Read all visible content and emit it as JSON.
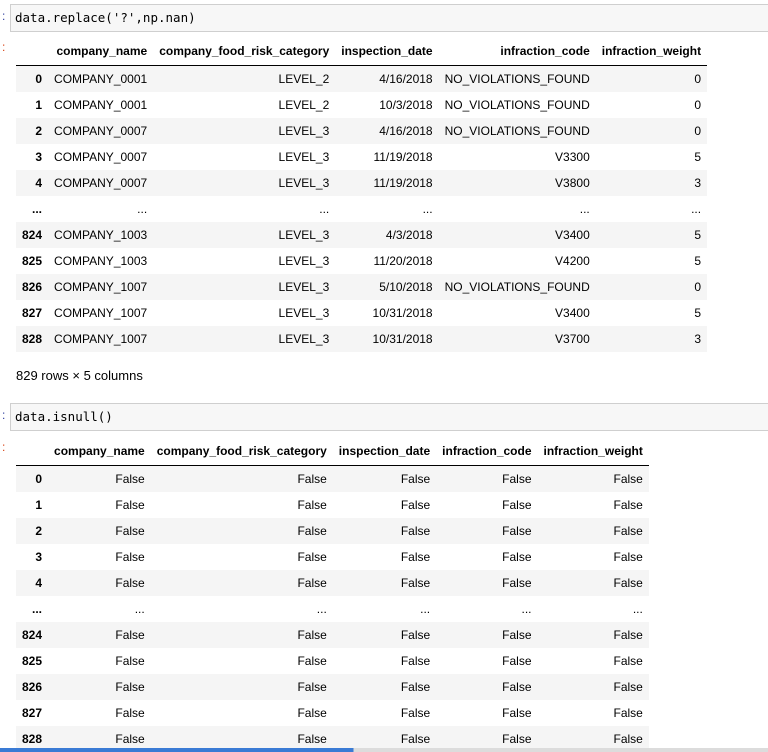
{
  "cell1": {
    "code": "data.replace('?',np.nan)",
    "columns": [
      "company_name",
      "company_food_risk_category",
      "inspection_date",
      "infraction_code",
      "infraction_weight"
    ],
    "rows": [
      {
        "index": "0",
        "cells": [
          "COMPANY_0001",
          "LEVEL_2",
          "4/16/2018",
          "NO_VIOLATIONS_FOUND",
          "0"
        ]
      },
      {
        "index": "1",
        "cells": [
          "COMPANY_0001",
          "LEVEL_2",
          "10/3/2018",
          "NO_VIOLATIONS_FOUND",
          "0"
        ]
      },
      {
        "index": "2",
        "cells": [
          "COMPANY_0007",
          "LEVEL_3",
          "4/16/2018",
          "NO_VIOLATIONS_FOUND",
          "0"
        ]
      },
      {
        "index": "3",
        "cells": [
          "COMPANY_0007",
          "LEVEL_3",
          "11/19/2018",
          "V3300",
          "5"
        ]
      },
      {
        "index": "4",
        "cells": [
          "COMPANY_0007",
          "LEVEL_3",
          "11/19/2018",
          "V3800",
          "3"
        ]
      },
      {
        "index": "...",
        "cells": [
          "...",
          "...",
          "...",
          "...",
          "..."
        ]
      },
      {
        "index": "824",
        "cells": [
          "COMPANY_1003",
          "LEVEL_3",
          "4/3/2018",
          "V3400",
          "5"
        ]
      },
      {
        "index": "825",
        "cells": [
          "COMPANY_1003",
          "LEVEL_3",
          "11/20/2018",
          "V4200",
          "5"
        ]
      },
      {
        "index": "826",
        "cells": [
          "COMPANY_1007",
          "LEVEL_3",
          "5/10/2018",
          "NO_VIOLATIONS_FOUND",
          "0"
        ]
      },
      {
        "index": "827",
        "cells": [
          "COMPANY_1007",
          "LEVEL_3",
          "10/31/2018",
          "V3400",
          "5"
        ]
      },
      {
        "index": "828",
        "cells": [
          "COMPANY_1007",
          "LEVEL_3",
          "10/31/2018",
          "V3700",
          "3"
        ]
      }
    ],
    "shape": "829 rows × 5 columns"
  },
  "cell2": {
    "code": "data.isnull()",
    "columns": [
      "company_name",
      "company_food_risk_category",
      "inspection_date",
      "infraction_code",
      "infraction_weight"
    ],
    "rows": [
      {
        "index": "0",
        "cells": [
          "False",
          "False",
          "False",
          "False",
          "False"
        ]
      },
      {
        "index": "1",
        "cells": [
          "False",
          "False",
          "False",
          "False",
          "False"
        ]
      },
      {
        "index": "2",
        "cells": [
          "False",
          "False",
          "False",
          "False",
          "False"
        ]
      },
      {
        "index": "3",
        "cells": [
          "False",
          "False",
          "False",
          "False",
          "False"
        ]
      },
      {
        "index": "4",
        "cells": [
          "False",
          "False",
          "False",
          "False",
          "False"
        ]
      },
      {
        "index": "...",
        "cells": [
          "...",
          "...",
          "...",
          "...",
          "..."
        ]
      },
      {
        "index": "824",
        "cells": [
          "False",
          "False",
          "False",
          "False",
          "False"
        ]
      },
      {
        "index": "825",
        "cells": [
          "False",
          "False",
          "False",
          "False",
          "False"
        ]
      },
      {
        "index": "826",
        "cells": [
          "False",
          "False",
          "False",
          "False",
          "False"
        ]
      },
      {
        "index": "827",
        "cells": [
          "False",
          "False",
          "False",
          "False",
          "False"
        ]
      },
      {
        "index": "828",
        "cells": [
          "False",
          "False",
          "False",
          "False",
          "False"
        ]
      }
    ]
  }
}
